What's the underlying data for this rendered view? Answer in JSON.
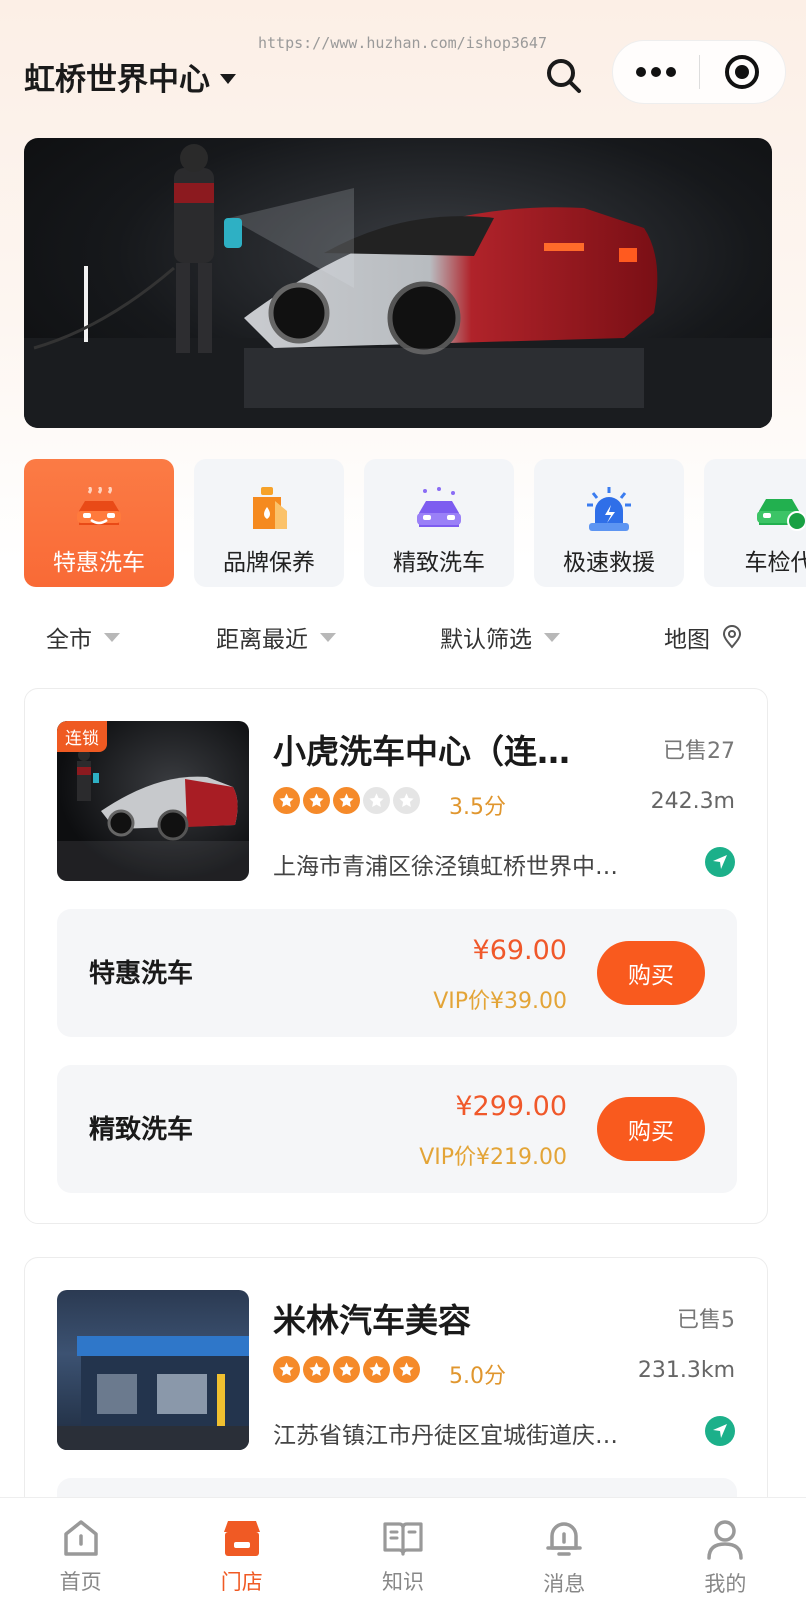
{
  "watermark": "https://www.huzhan.com/ishop3647",
  "header": {
    "location": "虹桥世界中心"
  },
  "categories": [
    {
      "label": "特惠洗车",
      "icon": "car-wash-icon",
      "active": true
    },
    {
      "label": "品牌保养",
      "icon": "oil-can-icon",
      "active": false
    },
    {
      "label": "精致洗车",
      "icon": "sparkle-car-icon",
      "active": false
    },
    {
      "label": "极速救援",
      "icon": "siren-icon",
      "active": false
    },
    {
      "label": "车检代",
      "icon": "inspection-car-icon",
      "active": false
    }
  ],
  "filters": {
    "city": "全市",
    "distance": "距离最近",
    "sort": "默认筛选",
    "map": "地图"
  },
  "stores": [
    {
      "badge": "连锁",
      "name": "小虎洗车中心（连…",
      "sold": "已售27",
      "rating": 3,
      "score": "3.5分",
      "distance": "242.3m",
      "address": "上海市青浦区徐泾镇虹桥世界中…",
      "services": [
        {
          "name": "特惠洗车",
          "price": "¥69.00",
          "vip": "VIP价¥39.00",
          "buy": "购买"
        },
        {
          "name": "精致洗车",
          "price": "¥299.00",
          "vip": "VIP价¥219.00",
          "buy": "购买"
        }
      ]
    },
    {
      "name": "米林汽车美容",
      "sold": "已售5",
      "rating": 5,
      "score": "5.0分",
      "distance": "231.3km",
      "address": "江苏省镇江市丹徒区宜城街道庆…"
    }
  ],
  "tabs": [
    {
      "label": "首页",
      "icon": "home-icon"
    },
    {
      "label": "门店",
      "icon": "store-icon",
      "active": true
    },
    {
      "label": "知识",
      "icon": "book-icon"
    },
    {
      "label": "消息",
      "icon": "bell-icon"
    },
    {
      "label": "我的",
      "icon": "user-icon"
    }
  ],
  "colors": {
    "accent": "#f95a1e",
    "score": "#e0962e",
    "vip": "#e3a437",
    "nav": "#1cb08a"
  }
}
